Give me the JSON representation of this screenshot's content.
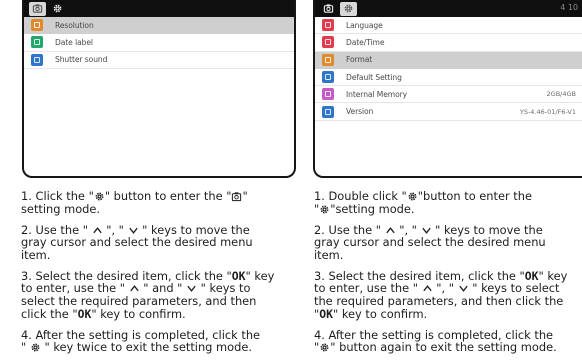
{
  "left_panel": {
    "tabs": [
      {
        "icon": "camera-icon",
        "active": true
      },
      {
        "icon": "gear-icon",
        "active": false
      }
    ],
    "menu_items": [
      {
        "label": "Resolution",
        "icon": "resolution-icon",
        "color": "#e08a2e",
        "selected": true
      },
      {
        "label": "Date label",
        "icon": "date-label-icon",
        "color": "#21a86b",
        "selected": false
      },
      {
        "label": "Shutter sound",
        "icon": "shutter-sound-icon",
        "color": "#2f76c8",
        "selected": false
      }
    ],
    "steps": {
      "s1": {
        "a": "1. Click the \"",
        "b": "\" button to enter the \"",
        "c": "\"",
        "d": "setting mode."
      },
      "s2": {
        "a": "2. Use the \" ",
        "b": " \", \" ",
        "c": " \" keys to move the",
        "d": "gray cursor and select the desired menu",
        "e": "item."
      },
      "s3": {
        "a": "3. Select the desired item, click the \"",
        "k1": "OK",
        "b": "\" key",
        "c": "to enter, use the \" ",
        "d": " \" and \" ",
        "e": " \" keys to",
        "f": "select the required parameters, and then",
        "g": "click the \"",
        "k2": "OK",
        "h": "\" key to confirm."
      },
      "s4": {
        "a": "4. After the setting is completed, click the",
        "b": "\" ",
        "c": " \" key twice to exit the setting mode."
      }
    }
  },
  "right_panel": {
    "tabs": [
      {
        "icon": "camera-icon",
        "active": false
      },
      {
        "icon": "gear-icon",
        "active": true
      }
    ],
    "badge": "4 10",
    "menu_items": [
      {
        "label": "Language",
        "icon": "language-icon",
        "color": "#e23b4e",
        "selected": false,
        "value": ""
      },
      {
        "label": "Date/Time",
        "icon": "date-time-icon",
        "color": "#e23b4e",
        "selected": false,
        "value": ""
      },
      {
        "label": "Format",
        "icon": "format-icon",
        "color": "#e08a2e",
        "selected": true,
        "value": ""
      },
      {
        "label": "Default Setting",
        "icon": "default-setting-icon",
        "color": "#2f76c8",
        "selected": false,
        "value": ""
      },
      {
        "label": "Internal Memory",
        "icon": "internal-memory-icon",
        "color": "#c65ac7",
        "selected": false,
        "value": "2GB/4GB"
      },
      {
        "label": "Version",
        "icon": "version-icon",
        "color": "#2f76c8",
        "selected": false,
        "value": "YS-4.46-01/F6-V1"
      }
    ],
    "steps": {
      "s1": {
        "a": "1. Double click \"",
        "b": "\"button to enter the",
        "c": "\"",
        "d": "\"setting mode."
      },
      "s2": {
        "a": "2. Use the \" ",
        "b": " \", \" ",
        "c": " \" keys to move the",
        "d": "gray cursor and select the desired menu",
        "e": "item."
      },
      "s3": {
        "a": "3. Select the desired item, click the \"",
        "k1": "OK",
        "b": "\" key",
        "c": "to enter, use the \" ",
        "d": " \", \" ",
        "e": " \" keys to select",
        "f": "the required parameters, and then click the",
        "g": "\"",
        "k2": "OK",
        "h": "\" key to confirm."
      },
      "s4": {
        "a": "4. After the setting is completed, click the",
        "b": "\"",
        "c": "\" button again to exit the setting mode."
      }
    }
  },
  "colors": {
    "screen_bar": "#0f0f0f",
    "selected_row": "#cfcfcf",
    "text": "#1d1d1d"
  }
}
